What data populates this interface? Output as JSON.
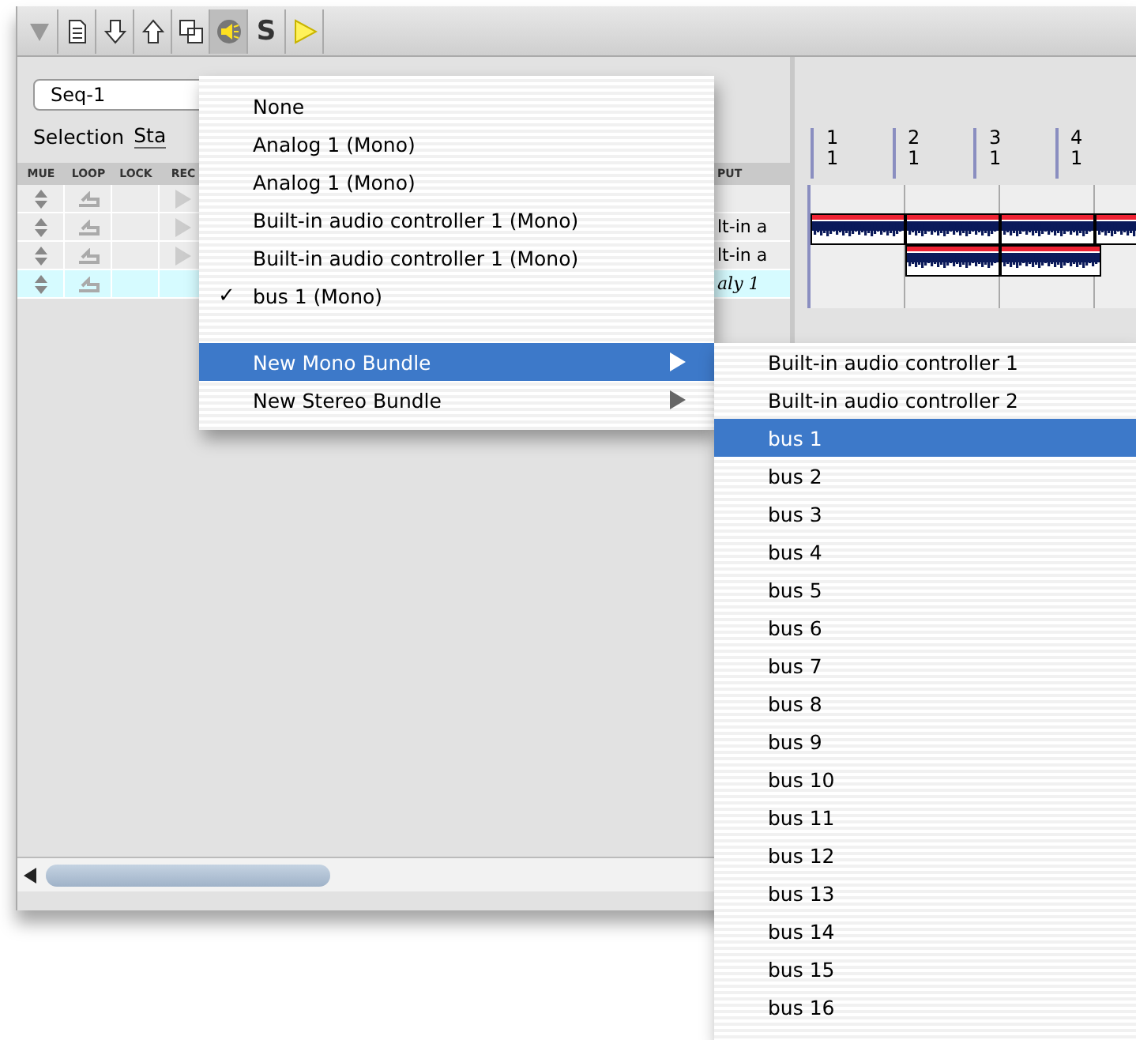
{
  "toolbar": {
    "buttons": [
      {
        "kind": "disclosure"
      },
      {
        "kind": "page"
      },
      {
        "kind": "down"
      },
      {
        "kind": "up"
      },
      {
        "kind": "windows"
      },
      {
        "kind": "speaker",
        "selected": true
      },
      {
        "kind": "letter",
        "label": "S"
      },
      {
        "kind": "play"
      }
    ]
  },
  "sequence": {
    "field_value": "Seq-1",
    "selection_label": "Selection",
    "selection_button": "Sta"
  },
  "track_table": {
    "columns": [
      "MUE",
      "LOOP",
      "LOCK",
      "REC"
    ],
    "output_header": "PUT",
    "rows": [
      {
        "selected": false
      },
      {
        "output": "lt-in a",
        "selected": false,
        "italic": false
      },
      {
        "output": "lt-in a",
        "selected": false,
        "italic": false
      },
      {
        "output": "aly 1",
        "selected": true,
        "italic": true
      }
    ]
  },
  "timeline": {
    "ruler": [
      {
        "bar": "1",
        "beat": "1"
      },
      {
        "bar": "2",
        "beat": "1"
      },
      {
        "bar": "3",
        "beat": "1"
      },
      {
        "bar": "4",
        "beat": "1"
      }
    ]
  },
  "input_menu": {
    "check_mark": "✓",
    "items": [
      {
        "kind": "item",
        "label": "None",
        "checked": false,
        "selected": false
      },
      {
        "kind": "item",
        "label": "Analog 1 (Mono)",
        "checked": false,
        "selected": false
      },
      {
        "kind": "item",
        "label": "Analog 1 (Mono)",
        "checked": false,
        "selected": false
      },
      {
        "kind": "item",
        "label": "Built-in audio controller 1 (Mono)",
        "checked": false,
        "selected": false
      },
      {
        "kind": "item",
        "label": "Built-in audio controller 1 (Mono)",
        "checked": false,
        "selected": false
      },
      {
        "kind": "item",
        "label": "bus 1 (Mono)",
        "checked": true,
        "selected": false
      },
      {
        "kind": "separator"
      },
      {
        "kind": "submenu",
        "label": "New Mono Bundle",
        "checked": false,
        "selected": true
      },
      {
        "kind": "submenu",
        "label": "New Stereo Bundle",
        "checked": false,
        "selected": false
      }
    ]
  },
  "bundle_submenu": {
    "items": [
      {
        "label": "Built-in audio controller 1",
        "selected": false
      },
      {
        "label": "Built-in audio controller 2",
        "selected": false
      },
      {
        "label": "bus 1",
        "selected": true
      },
      {
        "label": "bus 2",
        "selected": false
      },
      {
        "label": "bus 3",
        "selected": false
      },
      {
        "label": "bus 4",
        "selected": false
      },
      {
        "label": "bus 5",
        "selected": false
      },
      {
        "label": "bus 6",
        "selected": false
      },
      {
        "label": "bus 7",
        "selected": false
      },
      {
        "label": "bus 8",
        "selected": false
      },
      {
        "label": "bus 9",
        "selected": false
      },
      {
        "label": "bus 10",
        "selected": false
      },
      {
        "label": "bus 11",
        "selected": false
      },
      {
        "label": "bus 12",
        "selected": false
      },
      {
        "label": "bus 13",
        "selected": false
      },
      {
        "label": "bus 14",
        "selected": false
      },
      {
        "label": "bus 15",
        "selected": false
      },
      {
        "label": "bus 16",
        "selected": false
      }
    ]
  }
}
